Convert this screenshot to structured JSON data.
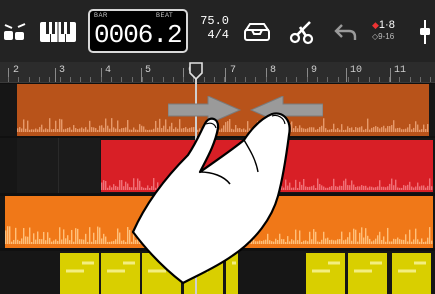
{
  "toolbar": {
    "drum_icon": "drum-kit-icon",
    "keyboard_icon": "piano-keyboard-icon",
    "position": {
      "label": "BAR",
      "beat_label": "BEAT",
      "value": "0006.2"
    },
    "tempo": {
      "bpm": "75.0",
      "signature": "4/4"
    },
    "loops_icon": "loop-browser-icon",
    "fx_icon": "edit-scissors-icon",
    "undo_icon": "undo-icon",
    "count_in": {
      "primary": "1·8",
      "secondary": "9-16"
    },
    "mixer_icon": "mixer-fader-icon"
  },
  "ruler": {
    "markers": [
      "2",
      "3",
      "4",
      "5",
      "6",
      "7",
      "8",
      "9",
      "10",
      "11"
    ]
  },
  "colors": {
    "track1": "#b8531a",
    "track2": "#d81f26",
    "track3": "#f07818",
    "track4": "#d9cf00"
  },
  "gesture": {
    "type": "pinch-zoom-out",
    "hand_icon": "pinching-hand-icon",
    "left_arrow": "arrow-right-icon",
    "right_arrow": "arrow-left-icon"
  }
}
